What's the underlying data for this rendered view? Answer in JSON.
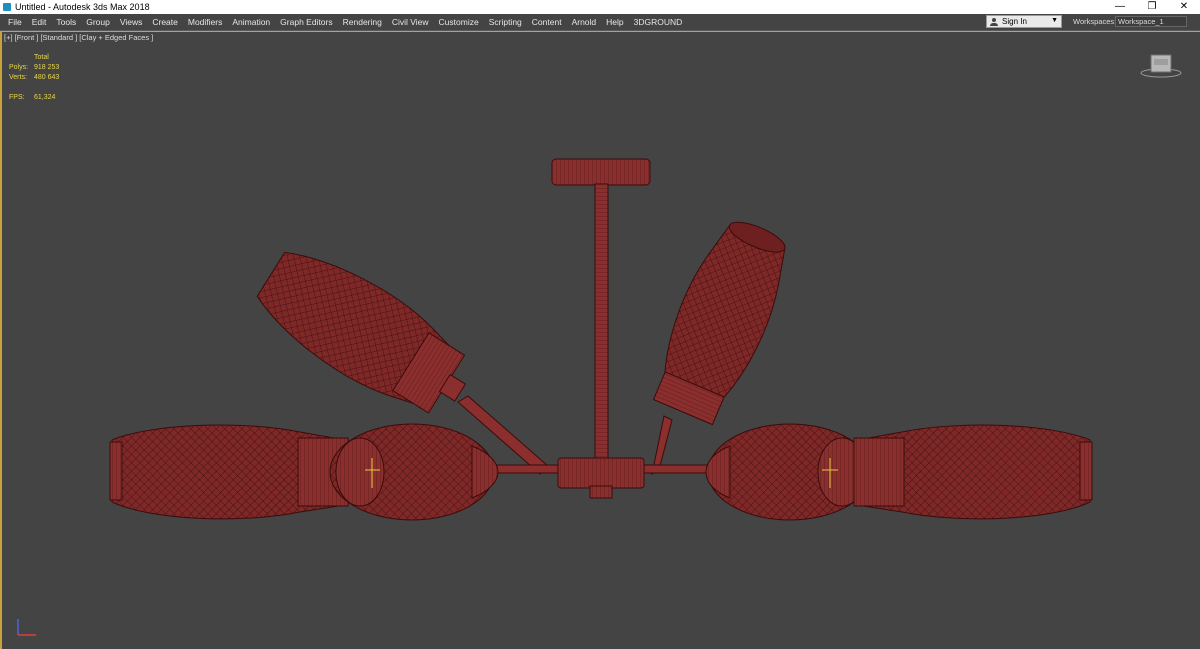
{
  "window": {
    "title": "Untitled - Autodesk 3ds Max 2018"
  },
  "window_controls": {
    "minimize": "—",
    "maximize": "❐",
    "close": "✕"
  },
  "menu": [
    "File",
    "Edit",
    "Tools",
    "Group",
    "Views",
    "Create",
    "Modifiers",
    "Animation",
    "Graph Editors",
    "Rendering",
    "Civil View",
    "Customize",
    "Scripting",
    "Content",
    "Arnold",
    "Help",
    "3DGROUND"
  ],
  "account": {
    "sign_in": "Sign In"
  },
  "workspace": {
    "label": "Workspaces:",
    "value": "Workspace_1"
  },
  "viewport": {
    "label": "[+] [Front ] [Standard ] [Clay + Edged Faces ]"
  },
  "stats": {
    "header": "Total",
    "polys_label": "Polys:",
    "polys_value": "918 253",
    "verts_label": "Verts:",
    "verts_value": "480 643",
    "fps_label": "FPS:",
    "fps_value": "61,324"
  },
  "colors": {
    "model": "#7e2828",
    "wire": "#3c0b0b",
    "viewport_bg": "#444444",
    "active_border": "#c8a23a",
    "stats_text": "#e8d64a"
  },
  "icons": [
    "app-icon",
    "user-icon",
    "chevron-down-icon",
    "viewcube-icon",
    "axis-tripod-icon"
  ]
}
